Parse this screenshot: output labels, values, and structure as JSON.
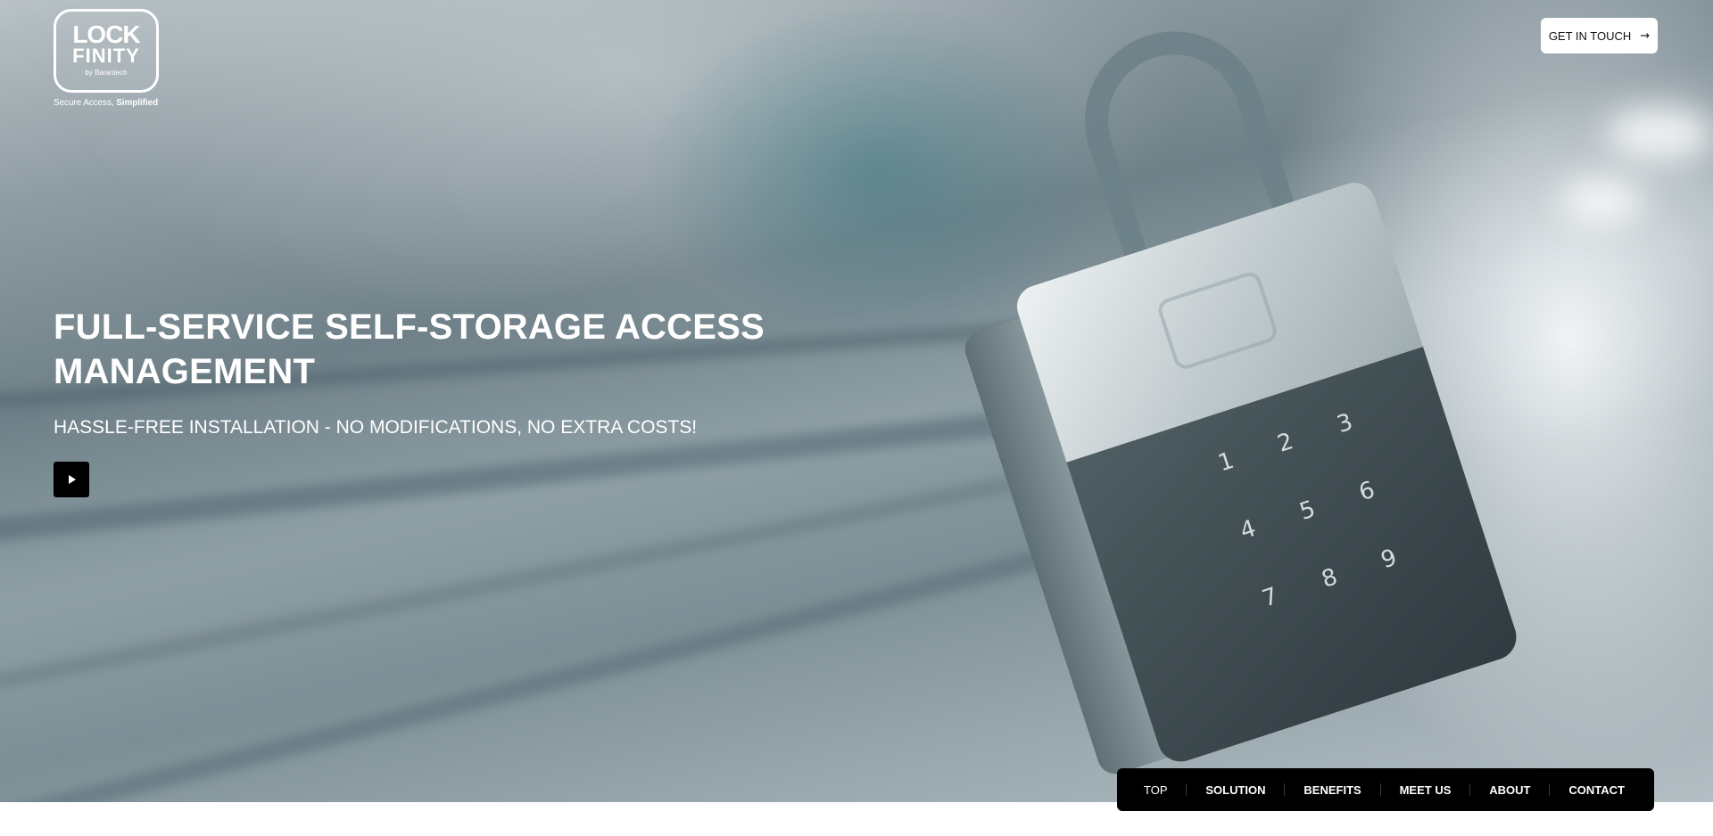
{
  "brand": {
    "logo_line1": "LOCK",
    "logo_line2": "FINITY",
    "logo_by": "by Barantech",
    "tagline_regular": "Secure Access, ",
    "tagline_bold": "Simplified"
  },
  "header": {
    "cta_label": "GET IN TOUCH",
    "cta_icon": "arrow-right-icon"
  },
  "hero": {
    "headline": "FULL-SERVICE SELF-STORAGE ACCESS MANAGEMENT",
    "subheadline": "HASSLE-FREE INSTALLATION - NO MODIFICATIONS, NO EXTRA COSTS!",
    "play_icon": "play-icon",
    "keypad_digits": [
      "1",
      "2",
      "3",
      "4",
      "5",
      "6",
      "7",
      "8",
      "9"
    ]
  },
  "nav": {
    "items": [
      {
        "label": "TOP"
      },
      {
        "label": "SOLUTION"
      },
      {
        "label": "BENEFITS"
      },
      {
        "label": "MEET US"
      },
      {
        "label": "ABOUT"
      },
      {
        "label": "CONTACT"
      }
    ],
    "active": "TOP"
  },
  "colors": {
    "nav_bg": "#000000",
    "cta_bg": "#ffffff",
    "text": "#ffffff"
  }
}
